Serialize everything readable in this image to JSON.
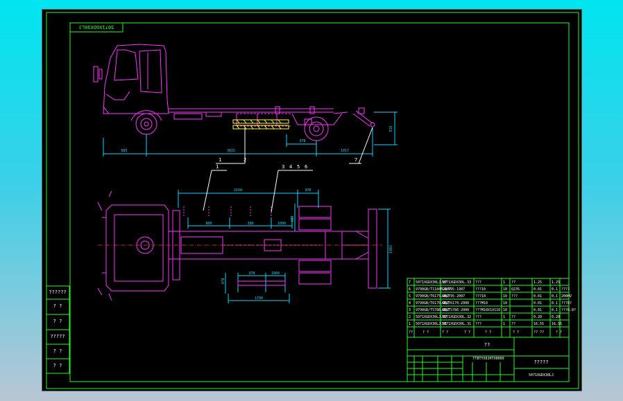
{
  "drawing": {
    "code_mirrored": "5071XGDX30LJ",
    "code_bottom": "5071XGDX30LJ",
    "part_number_center": "TTBTYX0JHTX0000",
    "title_block_name": "?????",
    "title_block_center": "??"
  },
  "side_view": {
    "dimensions": [
      "685",
      "3815",
      "978",
      "1017",
      "916"
    ],
    "callouts": [
      "1",
      "2",
      "7"
    ]
  },
  "top_view": {
    "dimensions": [
      "2150",
      "978",
      "1804",
      "800",
      "390",
      "1000",
      "600",
      "470",
      "1790",
      "1903",
      "978"
    ],
    "callouts": [
      "1",
      "3",
      "4",
      "5",
      "6"
    ]
  },
  "left_stamp": [
    "??????",
    "? ?",
    "? ?",
    "?????",
    "? ?",
    "? ?"
  ],
  "parts_list": [
    {
      "no": "7",
      "code": "5071XGDX30LJ.07",
      "name": "5071XGDX30L.33",
      "material": "???",
      "qty": "1",
      "unit": "??",
      "w1": "1.25",
      "w2": "1.25",
      "note": ""
    },
    {
      "no": "6",
      "code": "9790GB/T11845.007",
      "name": "GB/T95-1987",
      "material": "???10",
      "qty": "10",
      "unit": "Q235",
      "w1": "0.01",
      "w2": "0.1",
      "note": "????"
    },
    {
      "no": "5",
      "code": "9790GB/T6175.002",
      "name": "GB/T95-2007",
      "material": "???10",
      "qty": "10",
      "unit": "???",
      "w1": "0.01",
      "w2": "0.1",
      "note": "200HV"
    },
    {
      "no": "4",
      "code": "9790GB/T6170.002",
      "name": "GB/T6170-2000",
      "material": "???M10",
      "qty": "10",
      "unit": "",
      "w1": "0.01",
      "w2": "0.1",
      "note": "???8?"
    },
    {
      "no": "3",
      "code": "9790GB/T5786.002",
      "name": "GB/T5786-2000",
      "material": "???M10X1X110",
      "qty": "10",
      "unit": "",
      "w1": "0.01",
      "w2": "0.1",
      "note": "???8.8?"
    },
    {
      "no": "2",
      "code": "5071XGDX30LJ.02",
      "name": "5071XGDX30L.32",
      "material": "???",
      "qty": "1",
      "unit": "??",
      "w1": "0.20",
      "w2": "0.20",
      "note": ""
    },
    {
      "no": "1",
      "code": "5071XGDX30LJ.01",
      "name": "5071XGDX30L.31",
      "material": "???",
      "qty": "1",
      "unit": "??",
      "w1": "16.55",
      "w2": "16.55",
      "note": ""
    }
  ],
  "parts_header": [
    "??",
    "? ?",
    "? ?",
    "? ?",
    "? ?",
    "? ?",
    "?? ??",
    "? ?"
  ]
}
